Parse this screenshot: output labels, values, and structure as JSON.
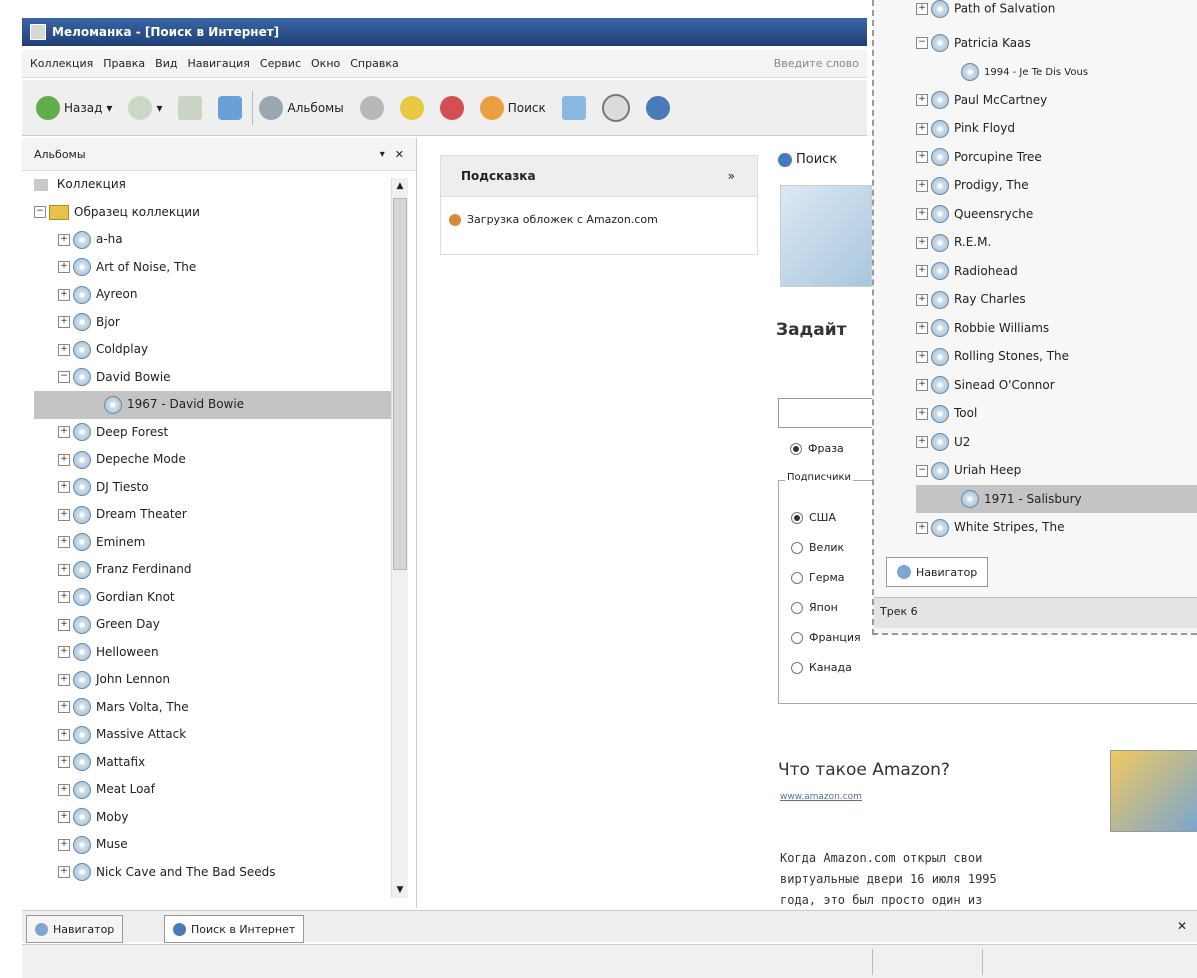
{
  "window": {
    "title": "Меломанка - [Поиск в Интернет]"
  },
  "menubar": {
    "items": [
      "Коллекция",
      "Правка",
      "Вид",
      "Навигация",
      "Сервис",
      "Окно",
      "Справка"
    ],
    "search_hint": "Введите слово"
  },
  "toolbar": {
    "back_label": "Назад",
    "albums_label": "Альбомы",
    "search_label": "Поиск"
  },
  "left_panel": {
    "title": "Альбомы",
    "root": "Коллекция",
    "sample": "Образец коллекции",
    "items": [
      "a-ha",
      "Art of Noise, The",
      "Ayreon",
      "Bjor",
      "Coldplay",
      "David Bowie",
      "1967 - David Bowie",
      "Deep Forest",
      "Depeche Mode",
      "DJ Tiesto",
      "Dream Theater",
      "Eminem",
      "Franz Ferdinand",
      "Gordian Knot",
      "Green Day",
      "Helloween",
      "John Lennon",
      "Mars Volta, The",
      "Massive Attack",
      "Mattafix",
      "Meat Loaf",
      "Moby",
      "Muse",
      "Nick Cave and The Bad Seeds"
    ]
  },
  "hint_panel": {
    "title": "Подсказка",
    "collapse": "»",
    "link": "Загрузка обложек с Amazon.com"
  },
  "web": {
    "heading": "Поиск",
    "prompt": "Задайт",
    "radio_top": "Фраза",
    "fieldset_title": "Подписчики",
    "radios": [
      "США",
      "Велик",
      "Герма",
      "Япон",
      "Франция",
      "Канада"
    ],
    "amazon_title": "Что такое Amazon?",
    "amazon_link": "www.amazon.com",
    "amazon_text": [
      "Когда Amazon.com открыл свои",
      "виртуальные двери 16 июля 1995",
      "года, это был просто один из"
    ]
  },
  "right_panel": {
    "items": [
      "Path of Salvation",
      "Patricia Kaas",
      "1994 - Je Te Dis Vous",
      "Paul McCartney",
      "Pink Floyd",
      "Porcupine Tree",
      "Prodigy, The",
      "Queensryche",
      "R.E.M.",
      "Radiohead",
      "Ray Charles",
      "Robbie Williams",
      "Rolling Stones, The",
      "Sinead O'Connor",
      "Tool",
      "U2",
      "Uriah Heep",
      "1971 - Salisbury",
      "White Stripes, The"
    ],
    "tab": "Навигатор",
    "track": "Трек 6"
  },
  "bottom_tabs": [
    "Навигатор",
    "Поиск в Интернет"
  ],
  "close_symbol": "✕",
  "colors": {
    "titlebar": "#2a4f8a",
    "selection": "#c4c4c4",
    "panel": "#f2f2f2"
  }
}
